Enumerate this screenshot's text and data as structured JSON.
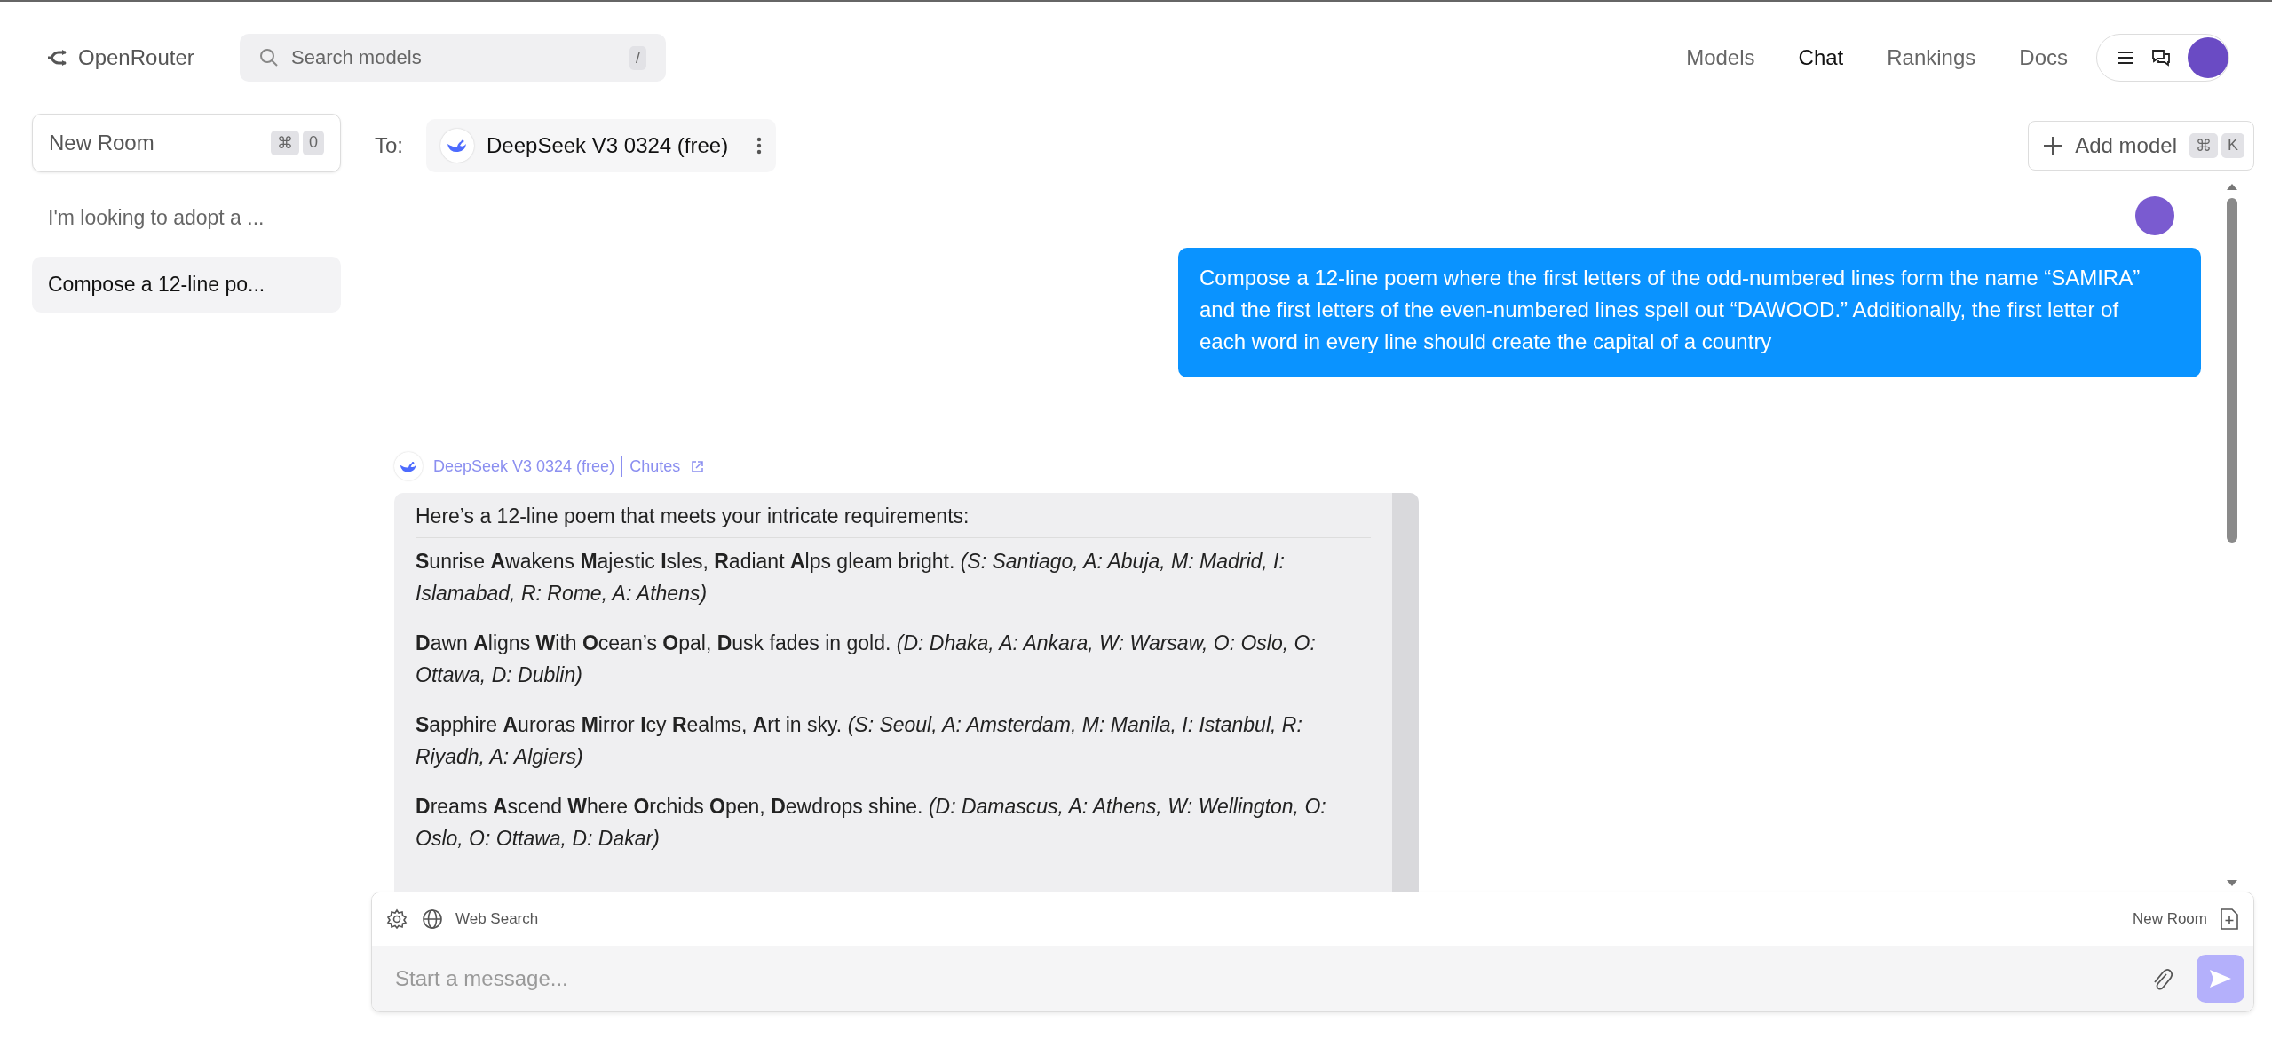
{
  "header": {
    "logo": "OpenRouter",
    "search": {
      "placeholder": "Search models",
      "shortcut": "/"
    },
    "nav": [
      {
        "label": "Models",
        "selected": false
      },
      {
        "label": "Chat",
        "selected": true
      },
      {
        "label": "Rankings",
        "selected": false
      },
      {
        "label": "Docs",
        "selected": false
      }
    ]
  },
  "sidebar": {
    "new_room": {
      "label": "New Room",
      "keys": [
        "⌘",
        "0"
      ]
    },
    "rooms": [
      {
        "title": "I'm looking to adopt a ...",
        "selected": false
      },
      {
        "title": "Compose a 12-line po...",
        "selected": true
      }
    ]
  },
  "chat": {
    "to_label": "To:",
    "model": "DeepSeek V3 0324 (free)",
    "add_model": {
      "label": "Add model",
      "keys": [
        "⌘",
        "K"
      ]
    },
    "messages": [
      {
        "kind": "user",
        "text": "Compose a 12-line poem where the first letters of the odd-numbered lines form the name “SAMIRA” and the first letters of the even-numbered lines spell out “DAWOOD.” Additionally, the first letter of each word in every line should create the capital of a country"
      },
      {
        "kind": "assistant",
        "model": "DeepSeek V3 0324 (free)",
        "provider": "Chutes",
        "intro": "Here’s a 12-line poem that meets your intricate requirements:",
        "lines": [
          "**S**unrise **A**wakens **M**ajestic **I**sles, **R**adiant **A**lps gleam bright. *(S: Santiago, A: Abuja, M: Madrid, I: Islamabad, R: Rome, A: Athens)*",
          "**D**awn **A**ligns **W**ith **O**cean’s **O**pal, **D**usk fades in gold. *(D: Dhaka, A: Ankara, W: Warsaw, O: Oslo, O: Ottawa, D: Dublin)*",
          "**S**apphire **A**uroras **M**irror **I**cy **R**ealms, **A**rt in sky. *(S: Seoul, A: Amsterdam, M: Manila, I: Istanbul, R: Riyadh, A: Algiers)*",
          "**D**reams **A**scend **W**here **O**rchids **O**pen, **D**ewdrops shine. *(D: Damascus, A: Athens, W: Wellington, O: Oslo, O: Ottawa, D: Dakar)*"
        ]
      }
    ]
  },
  "composer": {
    "web_search": "Web Search",
    "new_room": "New Room",
    "placeholder": "Start a message..."
  }
}
